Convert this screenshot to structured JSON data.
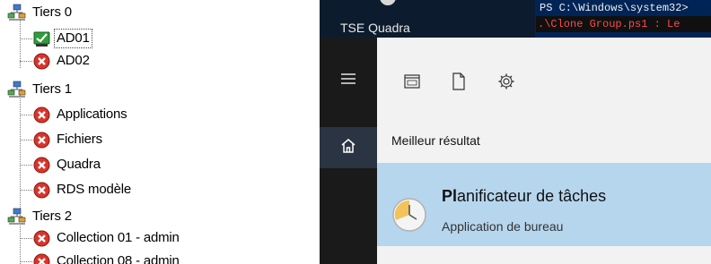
{
  "tree": {
    "groups": [
      {
        "label": "Tiers 0",
        "icon": "network-group-icon",
        "children": [
          {
            "label": "AD01",
            "status": "running",
            "icon": "vm-running-icon",
            "selected": true
          },
          {
            "label": "AD02",
            "status": "stopped",
            "icon": "vm-stopped-icon"
          }
        ]
      },
      {
        "label": "Tiers 1",
        "icon": "network-group-icon",
        "children": [
          {
            "label": "Applications",
            "status": "stopped",
            "icon": "vm-stopped-icon"
          },
          {
            "label": "Fichiers",
            "status": "stopped",
            "icon": "vm-stopped-icon"
          },
          {
            "label": "Quadra",
            "status": "stopped",
            "icon": "vm-stopped-icon"
          },
          {
            "label": "RDS modèle",
            "status": "stopped",
            "icon": "vm-stopped-icon"
          }
        ]
      },
      {
        "label": "Tiers 2",
        "icon": "network-group-icon",
        "children": [
          {
            "label": "Collection 01 - admin",
            "status": "stopped",
            "icon": "vm-stopped-icon"
          },
          {
            "label": "Collection 08 - admin",
            "status": "stopped",
            "icon": "vm-stopped-icon"
          }
        ]
      }
    ]
  },
  "taskbar": {
    "app_title": "TSE Quadra"
  },
  "powershell": {
    "prompt": "PS C:\\Windows\\system32>",
    "command": ".\\Clone Group.ps1 : Le"
  },
  "start_menu": {
    "rail": [
      {
        "name": "hamburger-menu-icon"
      },
      {
        "name": "home-icon",
        "active": true
      }
    ],
    "toolbar_icons": [
      "tablet-app-icon",
      "document-icon",
      "gear-icon"
    ],
    "best_result_label": "Meilleur résultat",
    "result": {
      "title_bold": "Pl",
      "title_rest": "anificateur de tâches",
      "subtitle": "Application de bureau",
      "icon": "clock-icon"
    }
  },
  "colors": {
    "selection": "#b6d6ee",
    "stopped": "#d9342b",
    "running": "#2e9e3a",
    "rail": "#1a1a1a",
    "taskbar": "#0c1c2e",
    "powershell_bg": "#012456"
  }
}
